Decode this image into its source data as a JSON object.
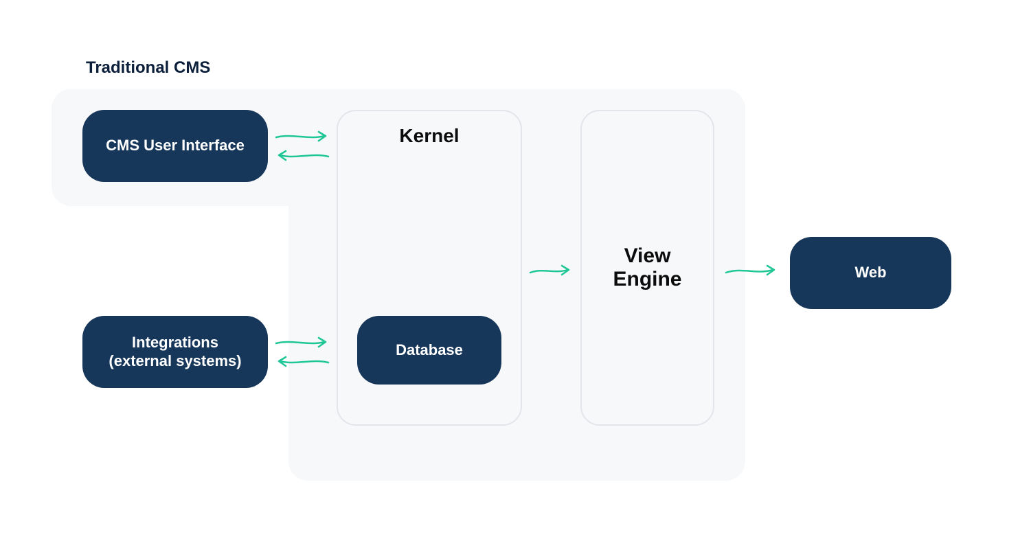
{
  "title": "Traditional CMS",
  "nodes": {
    "cms_ui": "CMS User Interface",
    "integrations_line1": "Integrations",
    "integrations_line2": "(external systems)",
    "kernel": "Kernel",
    "database": "Database",
    "view_engine_line1": "View",
    "view_engine_line2": "Engine",
    "web": "Web"
  },
  "colors": {
    "pill_bg": "#16365a",
    "pill_text": "#ffffff",
    "container_bg": "#f7f8fa",
    "outline": "#e2e5ea",
    "arrow": "#1fc796",
    "title": "#0c1f3a"
  }
}
